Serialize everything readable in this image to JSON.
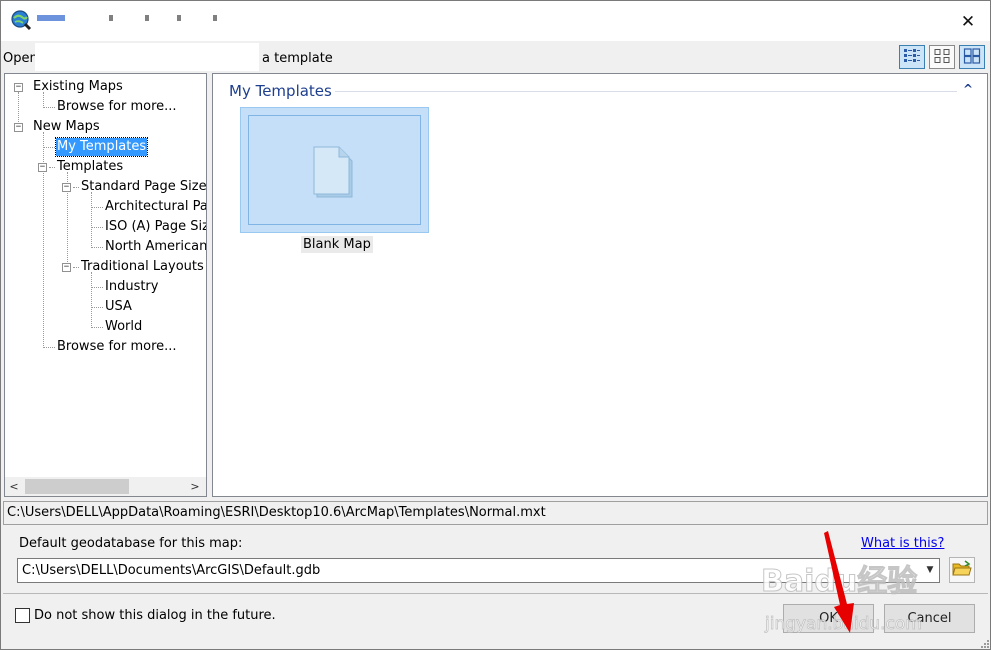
{
  "icons": {
    "app": "arcmap-globe-icon",
    "close": "close-icon",
    "views": [
      "details-view-icon",
      "medium-icons-view-icon",
      "large-icons-view-icon"
    ],
    "folder": "folder-open-icon",
    "document": "blank-document-icon"
  },
  "titlebar": {
    "close_glyph": "✕"
  },
  "toolbar": {
    "prompt_left": "Open",
    "prompt_right": "a template"
  },
  "tree": {
    "existing_maps": "Existing Maps",
    "browse_1": "Browse for more...",
    "new_maps": "New Maps",
    "my_templates": "My Templates",
    "templates": "Templates",
    "standard_page_sizes": "Standard Page Sizes",
    "architectural": "Architectural Pag",
    "iso": "ISO (A) Page Siz",
    "north_american": "North American (",
    "traditional_layouts": "Traditional Layouts",
    "industry": "Industry",
    "usa": "USA",
    "world": "World",
    "browse_2": "Browse for more...",
    "expand_minus": "−"
  },
  "scroll": {
    "left": "<",
    "right": ">"
  },
  "content": {
    "group_title": "My Templates",
    "collapse_glyph": "^",
    "template_name": "Blank Map"
  },
  "path": "C:\\Users\\DELL\\AppData\\Roaming\\ESRI\\Desktop10.6\\ArcMap\\Templates\\Normal.mxt",
  "gdb": {
    "label": "Default geodatabase for this map:",
    "value": "C:\\Users\\DELL\\Documents\\ArcGIS\\Default.gdb",
    "drop_glyph": "▼",
    "what_is_this": "What is this?"
  },
  "footer": {
    "dont_show": "Do not show this dialog in the future.",
    "ok": "OK",
    "cancel": "Cancel"
  },
  "watermark": {
    "brand": "Baidu经验",
    "url": "jingyan.baidu.com"
  },
  "colors": {
    "selection": "#3399ff",
    "group_header": "#1e3f8f",
    "tile": "#c4dff7",
    "link": "#0000ee",
    "annotation_arrow": "#e60000"
  }
}
